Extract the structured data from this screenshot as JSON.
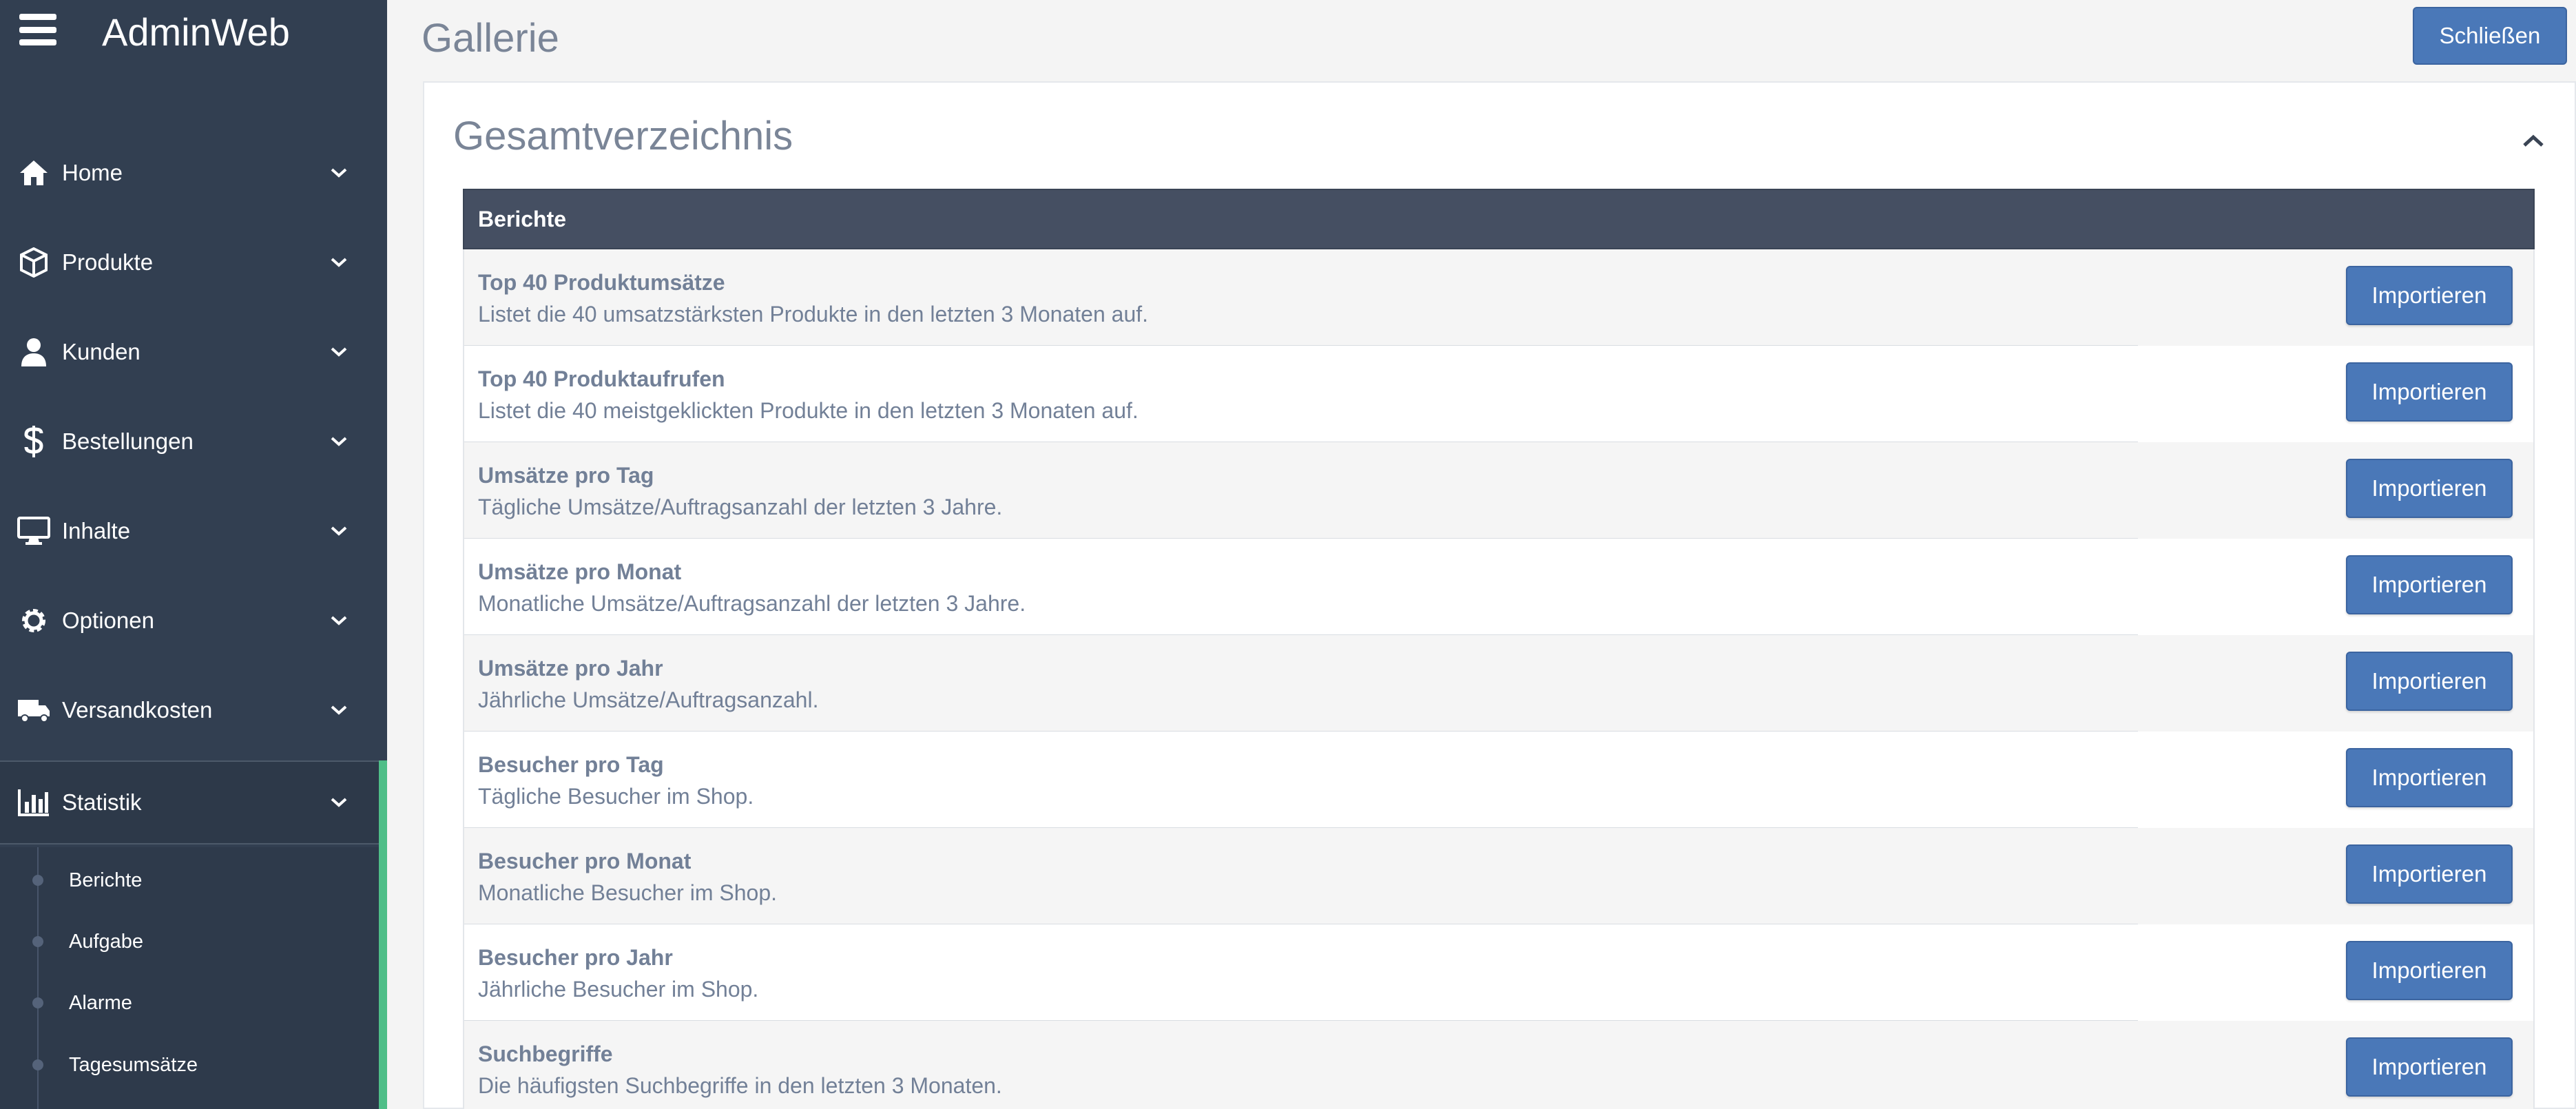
{
  "app": {
    "title": "AdminWeb"
  },
  "sidebar": {
    "items": [
      {
        "label": "Home",
        "icon": "home-icon"
      },
      {
        "label": "Produkte",
        "icon": "box-icon"
      },
      {
        "label": "Kunden",
        "icon": "user-icon"
      },
      {
        "label": "Bestellungen",
        "icon": "dollar-icon"
      },
      {
        "label": "Inhalte",
        "icon": "monitor-icon"
      },
      {
        "label": "Optionen",
        "icon": "gear-icon"
      },
      {
        "label": "Versandkosten",
        "icon": "truck-icon"
      },
      {
        "label": "Statistik",
        "icon": "bar-chart-icon",
        "active": true
      }
    ],
    "subitems": [
      {
        "label": "Berichte"
      },
      {
        "label": "Aufgabe"
      },
      {
        "label": "Alarme"
      },
      {
        "label": "Tagesumsätze"
      }
    ]
  },
  "header": {
    "title": "Gallerie",
    "close_label": "Schließen"
  },
  "panel": {
    "title": "Gesamtverzeichnis",
    "table_header": "Berichte",
    "import_label": "Importieren",
    "rows": [
      {
        "title": "Top 40 Produktumsätze",
        "desc": "Listet die 40 umsatzstärksten Produkte in den letzten 3 Monaten auf."
      },
      {
        "title": "Top 40 Produktaufrufen",
        "desc": "Listet die 40 meistgeklickten Produkte in den letzten 3 Monaten auf."
      },
      {
        "title": "Umsätze pro Tag",
        "desc": "Tägliche Umsätze/Auftragsanzahl der letzten 3 Jahre."
      },
      {
        "title": "Umsätze pro Monat",
        "desc": "Monatliche Umsätze/Auftragsanzahl der letzten 3 Jahre."
      },
      {
        "title": "Umsätze pro Jahr",
        "desc": "Jährliche Umsätze/Auftragsanzahl."
      },
      {
        "title": "Besucher pro Tag",
        "desc": "Tägliche Besucher im Shop."
      },
      {
        "title": "Besucher pro Monat",
        "desc": "Monatliche Besucher im Shop."
      },
      {
        "title": "Besucher pro Jahr",
        "desc": "Jährliche Besucher im Shop."
      },
      {
        "title": "Suchbegriffe",
        "desc": "Die häufigsten Suchbegriffe in den letzten 3 Monaten."
      }
    ]
  },
  "colors": {
    "sidebar_bg": "#323f51",
    "accent": "#4a78b8",
    "active_indicator": "#4fbe88",
    "table_header_bg": "#454f62"
  }
}
